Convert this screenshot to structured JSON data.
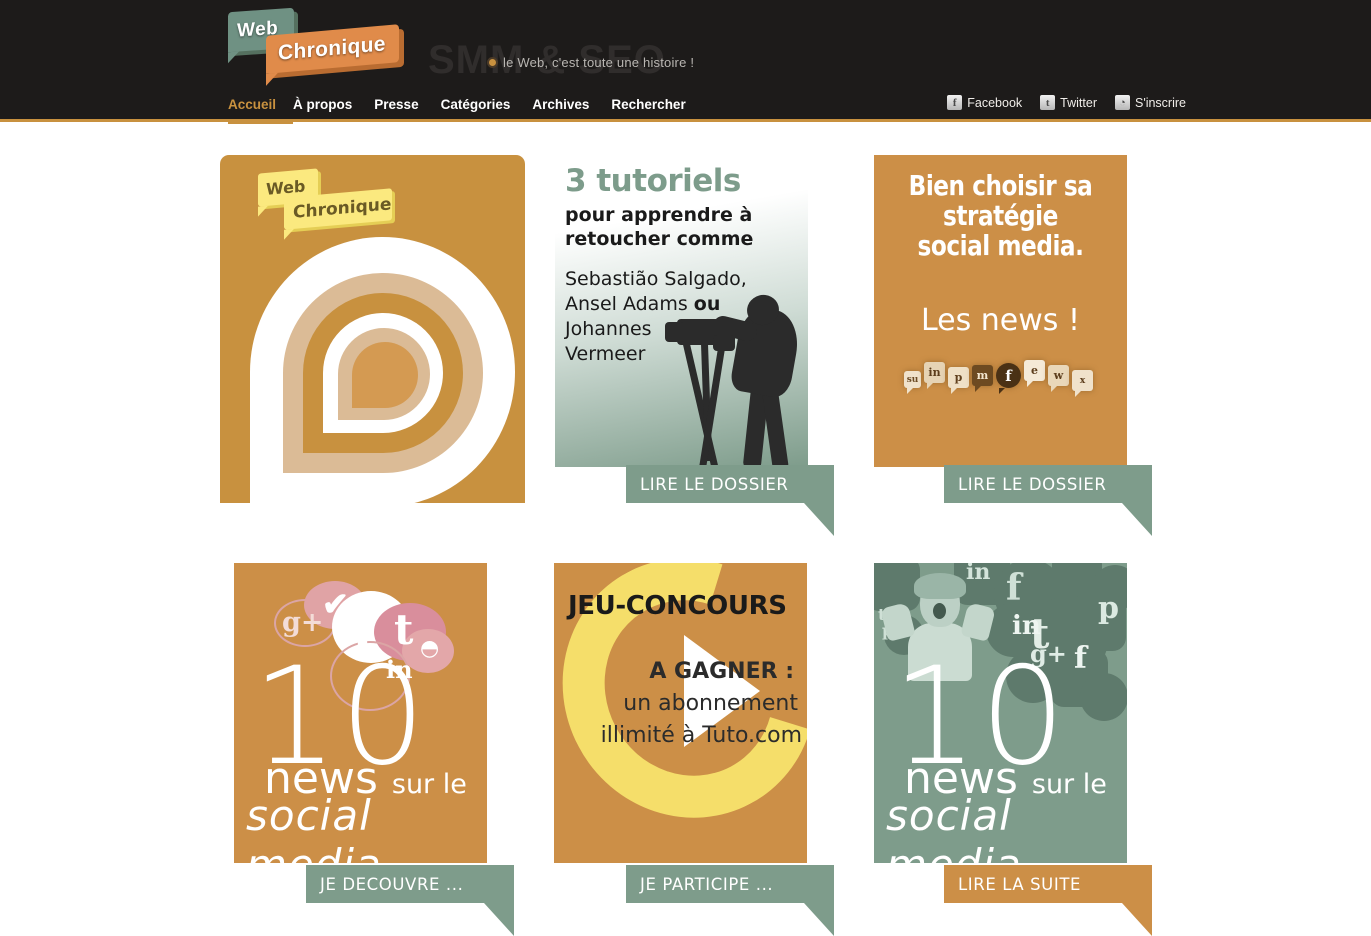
{
  "header": {
    "logo": {
      "line1": "Web",
      "line2": "Chronique"
    },
    "watermark": "SMM & SEO",
    "tagline": "le Web, c'est toute une histoire !",
    "nav": [
      {
        "label": "Accueil",
        "active": true
      },
      {
        "label": "À propos",
        "active": false
      },
      {
        "label": "Presse",
        "active": false
      },
      {
        "label": "Catégories",
        "active": false
      },
      {
        "label": "Archives",
        "active": false
      },
      {
        "label": "Rechercher",
        "active": false
      }
    ],
    "social": [
      {
        "label": "Facebook",
        "glyph": "f",
        "icon": "facebook-icon"
      },
      {
        "label": "Twitter",
        "glyph": "t",
        "icon": "twitter-icon"
      },
      {
        "label": "S'inscrire",
        "glyph": "◔",
        "icon": "rss-icon"
      }
    ]
  },
  "cards": {
    "logo_panel": {
      "mini_logo_line1": "Web",
      "mini_logo_line2": "Chronique"
    },
    "tutorials": {
      "title": "3 tutoriels",
      "subtitle": "pour apprendre à\nretoucher comme",
      "line_a": "Sebastião Salgado,",
      "line_b_pre": "Ansel Adams ",
      "line_b_bold": "ou",
      "line_b_post": " Johannes",
      "line_c": "Vermeer",
      "button": "LIRE LE DOSSIER"
    },
    "strategy": {
      "title": "Bien choisir sa\nstratégie\nsocial media.",
      "news": "Les news !",
      "icons": [
        "su",
        "in",
        "p",
        "m",
        "f",
        "e",
        "w",
        "x"
      ],
      "button": "LIRE LE DOSSIER"
    },
    "news_orange": {
      "number": "10",
      "word": "news",
      "suffix": "sur le",
      "tagline": "social media",
      "button": "JE DECOUVRE ..."
    },
    "contest": {
      "title": "JEU-CONCOURS",
      "win_label": "A GAGNER :",
      "prize_line1": "un abonnement",
      "prize_line2": "illimité à Tuto.com",
      "button": "JE PARTICIPE ..."
    },
    "news_green": {
      "number": "10",
      "word": "news",
      "suffix": "sur le",
      "tagline": "social media",
      "button": "LIRE LA SUITE"
    }
  },
  "colors": {
    "header_bg": "#1d1b1a",
    "accent_orange": "#c8913f",
    "card_orange": "#cc8f47",
    "card_green": "#7e9c8b",
    "yellow": "#f5de6a"
  }
}
